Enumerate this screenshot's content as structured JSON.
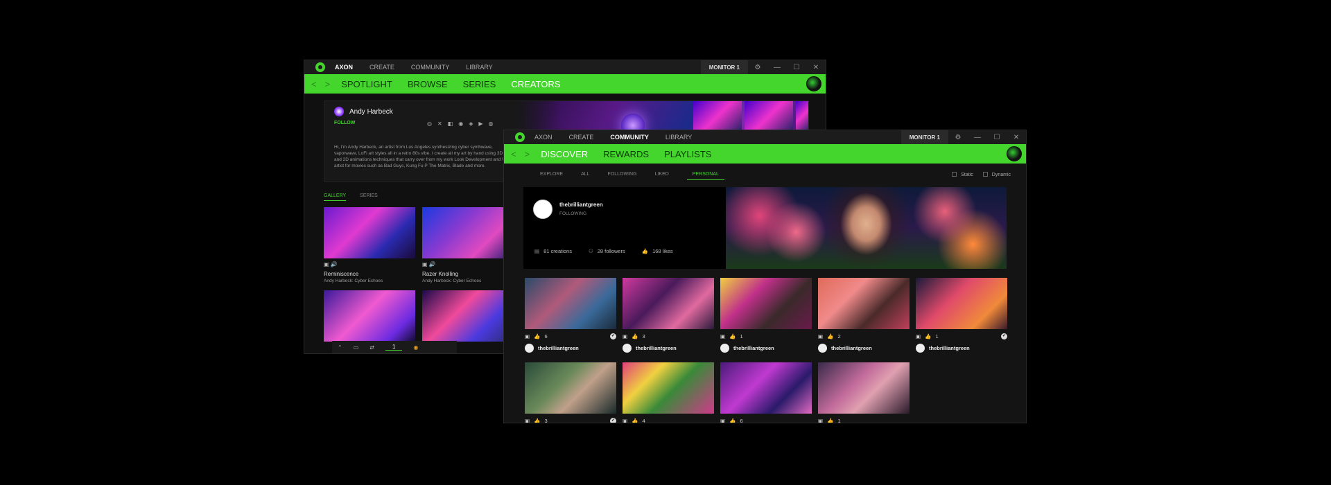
{
  "colors": {
    "accent": "#44d62c",
    "window_bg": "#101010",
    "titlebar": "#1c1c1c"
  },
  "back_window": {
    "topnav": [
      "AXON",
      "CREATE",
      "COMMUNITY",
      "LIBRARY"
    ],
    "active_topnav": "AXON",
    "monitor": "MONITOR 1",
    "subnav": [
      "SPOTLIGHT",
      "BROWSE",
      "SERIES",
      "CREATORS"
    ],
    "creator": {
      "name": "Andy Harbeck",
      "follow": "FOLLOW",
      "bio": "Hi, I'm Andy Harbeck, an artist from Los Angeles synthesizing cyber synthwave, vaporwave, LoFi art styles all in a retro 80s vibe. I create all my art by hand using 3D and 2D animations techniques that carry over from my work Look Development and VFX artist for movies such as Bad Guys, Kung Fu P The Matrix, Blade and more.",
      "socials": [
        "◎",
        "✕",
        "◧",
        "◉",
        "◈",
        "▶",
        "◍"
      ]
    },
    "tabs": [
      "GALLERY",
      "SERIES"
    ],
    "gallery": [
      {
        "title": "Reminiscence",
        "subtitle": "Andy Harbeck: Cyber Echoes"
      },
      {
        "title": "Razer Knolling",
        "subtitle": "Andy Harbeck: Cyber Echoes"
      },
      {
        "title": "",
        "subtitle": ""
      },
      {
        "title": "",
        "subtitle": ""
      }
    ],
    "bottom_bar": {
      "page": "1"
    }
  },
  "front_window": {
    "topnav": [
      "AXON",
      "CREATE",
      "COMMUNITY",
      "LIBRARY"
    ],
    "active_topnav": "COMMUNITY",
    "monitor": "MONITOR 1",
    "subnav": [
      "DISCOVER",
      "REWARDS",
      "PLAYLISTS"
    ],
    "tabs": [
      "EXPLORE",
      "ALL",
      "FOLLOWING",
      "LIKED",
      "PERSONAL"
    ],
    "active_tab": "PERSONAL",
    "toggles": [
      "Static",
      "Dynamic"
    ],
    "profile": {
      "name": "thebrilliantgreen",
      "status": "FOLLOWING",
      "stats": [
        "81 creations",
        "28 followers",
        "168 likes"
      ]
    },
    "grid": [
      {
        "likes": "6",
        "author": "thebrilliantgreen",
        "check": true
      },
      {
        "likes": "3",
        "author": "thebrilliantgreen",
        "check": false
      },
      {
        "likes": "1",
        "author": "thebrilliantgreen",
        "check": false
      },
      {
        "likes": "2",
        "author": "thebrilliantgreen",
        "check": false
      },
      {
        "likes": "1",
        "author": "thebrilliantgreen",
        "check": true
      },
      {
        "likes": "3",
        "author": "",
        "check": true
      },
      {
        "likes": "4",
        "author": "",
        "check": false
      },
      {
        "likes": "6",
        "author": "",
        "check": false
      },
      {
        "likes": "1",
        "author": "",
        "check": false
      }
    ]
  }
}
